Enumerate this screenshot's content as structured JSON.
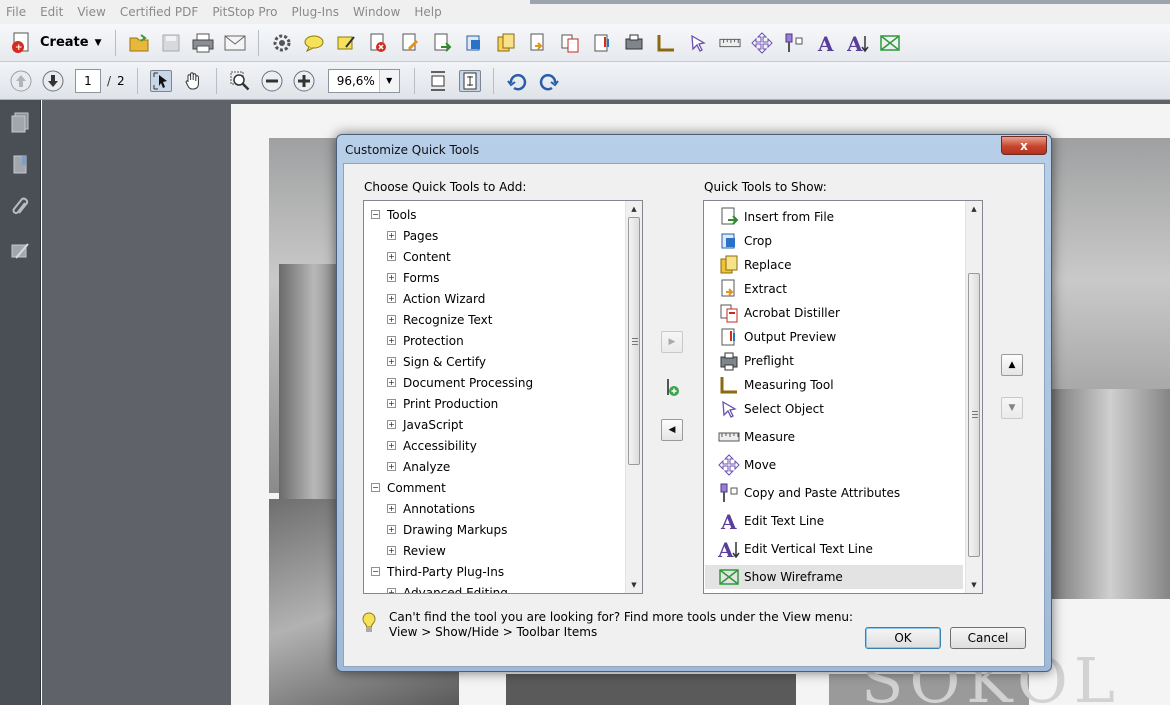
{
  "menu": [
    "File",
    "Edit",
    "View",
    "Certified PDF",
    "PitStop Pro",
    "Plug-Ins",
    "Window",
    "Help"
  ],
  "toolbar": {
    "create_label": "Create",
    "current_page": "1",
    "page_separator": "/",
    "total_pages": "2",
    "zoom": "96,6%"
  },
  "dialog": {
    "title": "Customize Quick Tools",
    "close_label": "x",
    "left_header": "Choose Quick Tools to Add:",
    "right_header": "Quick Tools to Show:",
    "tree": [
      {
        "label": "Tools",
        "expanded": true,
        "level": 0
      },
      {
        "label": "Pages",
        "level": 1
      },
      {
        "label": "Content",
        "level": 1
      },
      {
        "label": "Forms",
        "level": 1
      },
      {
        "label": "Action Wizard",
        "level": 1
      },
      {
        "label": "Recognize Text",
        "level": 1
      },
      {
        "label": "Protection",
        "level": 1
      },
      {
        "label": "Sign & Certify",
        "level": 1
      },
      {
        "label": "Document Processing",
        "level": 1
      },
      {
        "label": "Print Production",
        "level": 1
      },
      {
        "label": "JavaScript",
        "level": 1
      },
      {
        "label": "Accessibility",
        "level": 1
      },
      {
        "label": "Analyze",
        "level": 1
      },
      {
        "label": "Comment",
        "expanded": true,
        "level": 0
      },
      {
        "label": "Annotations",
        "level": 1
      },
      {
        "label": "Drawing Markups",
        "level": 1
      },
      {
        "label": "Review",
        "level": 1
      },
      {
        "label": "Third-Party Plug-Ins",
        "expanded": true,
        "level": 0
      },
      {
        "label": "Advanced Editing",
        "level": 1
      }
    ],
    "quick_tools": [
      {
        "label": "Insert from File",
        "icon": "insert-from-file-icon"
      },
      {
        "label": "Crop",
        "icon": "crop-icon"
      },
      {
        "label": "Replace",
        "icon": "replace-icon"
      },
      {
        "label": "Extract",
        "icon": "extract-icon"
      },
      {
        "label": "Acrobat Distiller",
        "icon": "acrobat-distiller-icon"
      },
      {
        "label": "Output Preview",
        "icon": "output-preview-icon"
      },
      {
        "label": "Preflight",
        "icon": "preflight-icon"
      },
      {
        "label": "Measuring Tool",
        "icon": "measuring-tool-icon"
      },
      {
        "label": "Select Object",
        "icon": "select-object-icon"
      },
      {
        "label": "Measure",
        "icon": "measure-icon"
      },
      {
        "label": "Move",
        "icon": "move-icon"
      },
      {
        "label": "Copy and Paste Attributes",
        "icon": "copy-paste-attributes-icon"
      },
      {
        "label": "Edit Text Line",
        "icon": "edit-text-line-icon"
      },
      {
        "label": "Edit Vertical Text Line",
        "icon": "edit-vertical-text-line-icon"
      },
      {
        "label": "Show Wireframe",
        "icon": "show-wireframe-icon",
        "selected": true
      }
    ],
    "hint_line1": "Can't find the tool you are looking for? Find more tools under the View menu:",
    "hint_line2": "View > Show/Hide > Toolbar Items",
    "ok_label": "OK",
    "cancel_label": "Cancel"
  },
  "background_text": "SOKOL",
  "colors": {
    "dialog_frame": "#a9c2df",
    "nav_panel": "#4a4f56",
    "doc_background": "#5f6369",
    "close_button": "#c7452e",
    "selection": "#e3e3e3"
  }
}
